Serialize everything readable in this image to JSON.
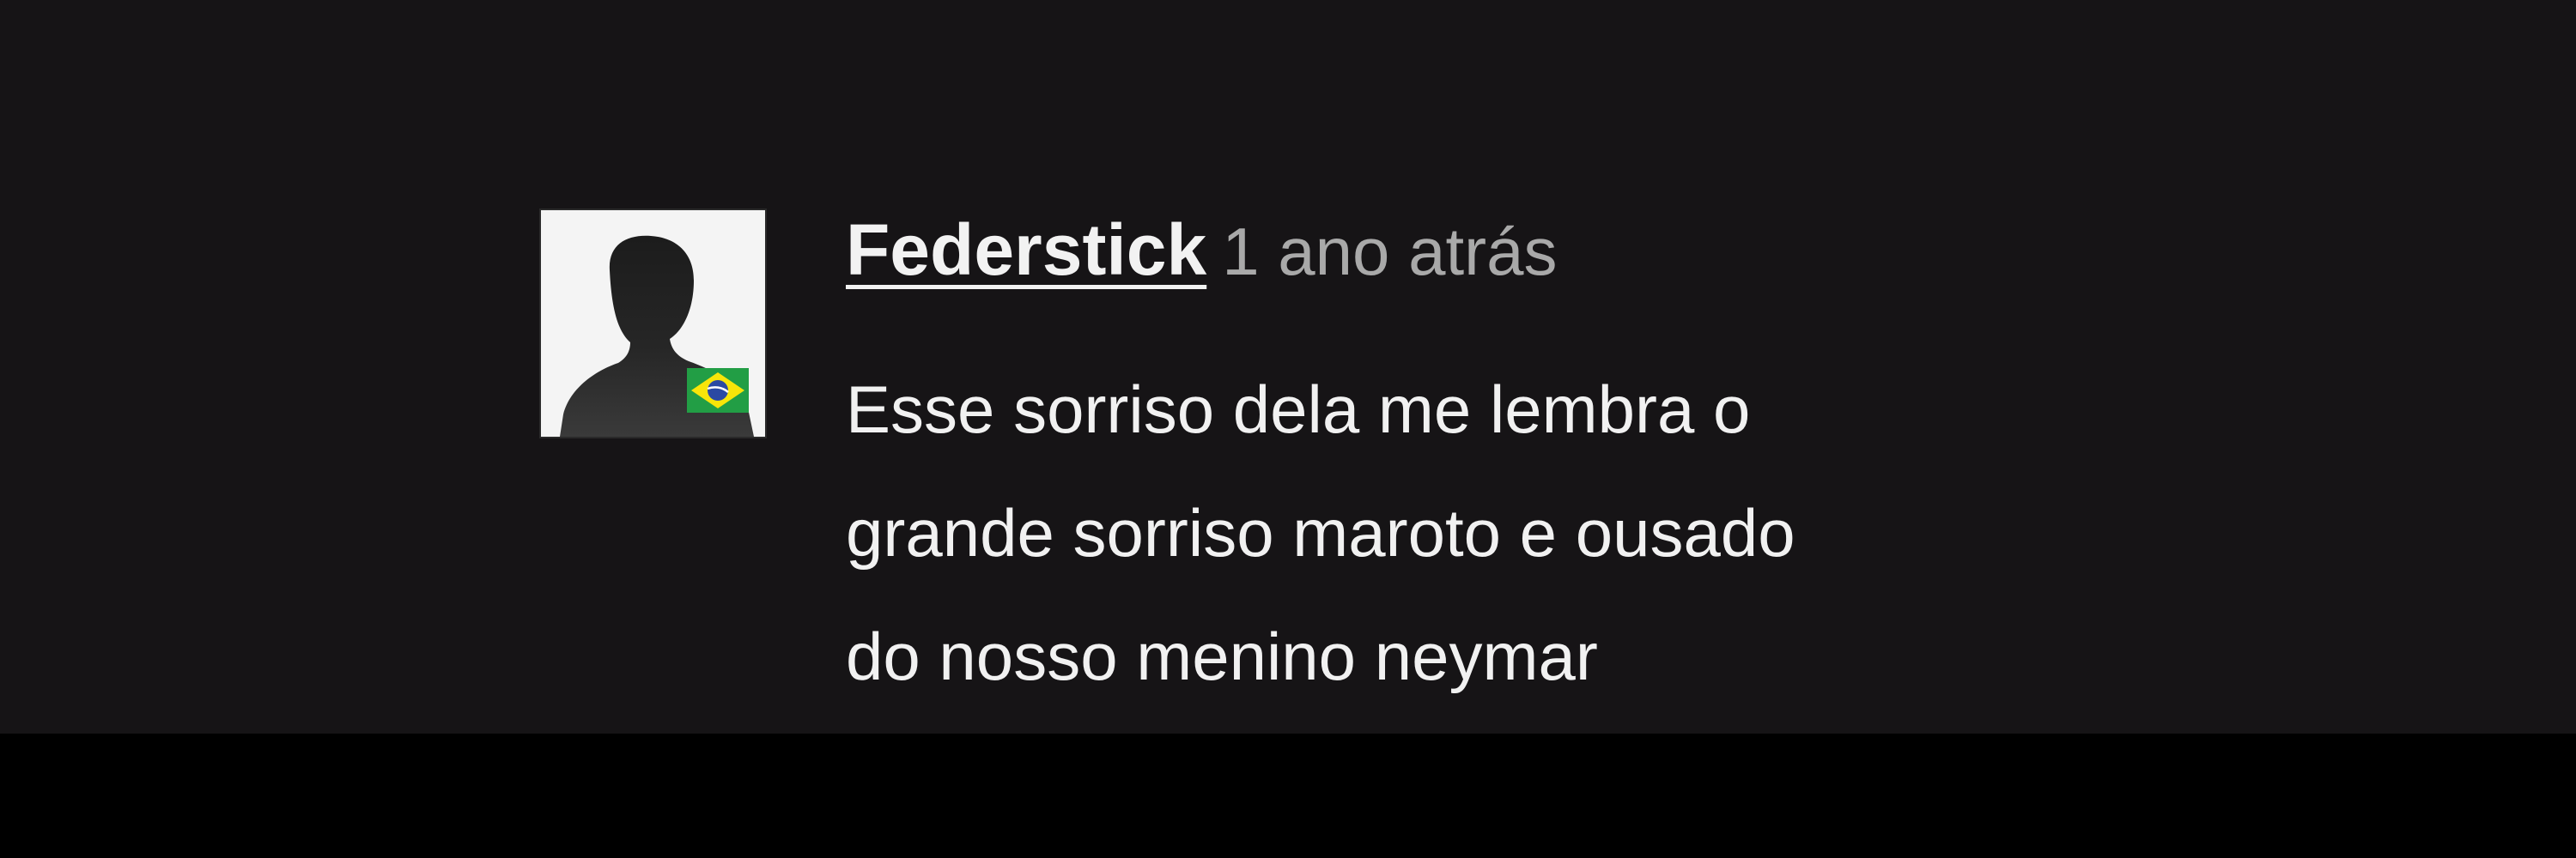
{
  "comment": {
    "username": "Federstick",
    "timestamp": "1 ano atrás",
    "lines": [
      "Esse sorriso dela me lembra o",
      "grande sorriso maroto e ousado",
      "do nosso menino neymar"
    ]
  },
  "avatar": {
    "icon": "person-silhouette-icon",
    "badge_icon": "brazil-flag-icon"
  },
  "colors": {
    "panel_background": "#161416",
    "bottom_bar": "#000000",
    "username_text": "#f2f2f2",
    "timestamp_text": "#a9a9a9",
    "body_text": "#f1f1f1",
    "flag_green": "#229e45",
    "flag_yellow": "#f8e509",
    "flag_blue": "#2b49a3"
  }
}
